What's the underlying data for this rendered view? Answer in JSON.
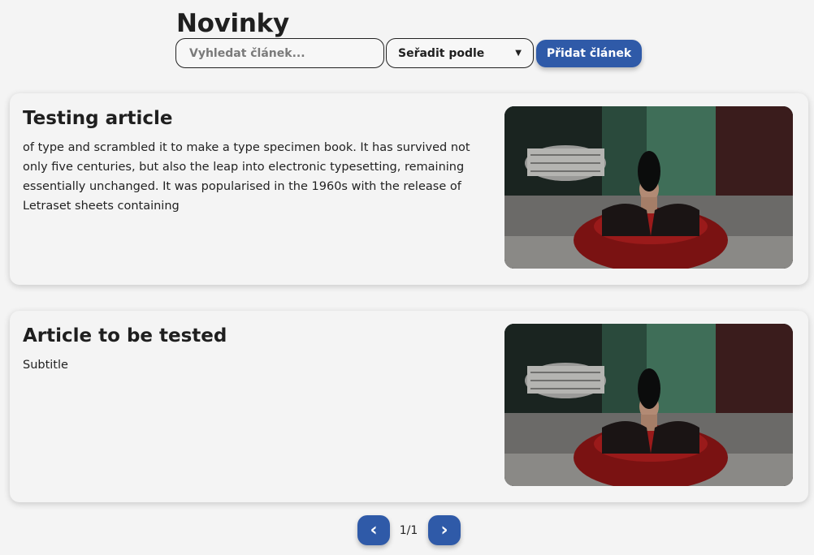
{
  "header": {
    "title": "Novinky"
  },
  "toolbar": {
    "search_placeholder": "Vyhledat článek...",
    "sort_label": "Seřadit podle",
    "add_label": "Přidat článek"
  },
  "articles": [
    {
      "title": "Testing article",
      "body": "of type and scrambled it to make a type specimen book. It has survived not only five centuries, but also the leap into electronic typesetting, remaining essentially unchanged. It was popularised in the 1960s with the release of Letraset sheets containing"
    },
    {
      "title": "Article to be tested",
      "body": "Subtitle"
    }
  ],
  "pagination": {
    "prev": "‹",
    "next": "›",
    "current": "1/1"
  },
  "colors": {
    "accent": "#2f5aa8",
    "background": "#f4f4f4"
  }
}
